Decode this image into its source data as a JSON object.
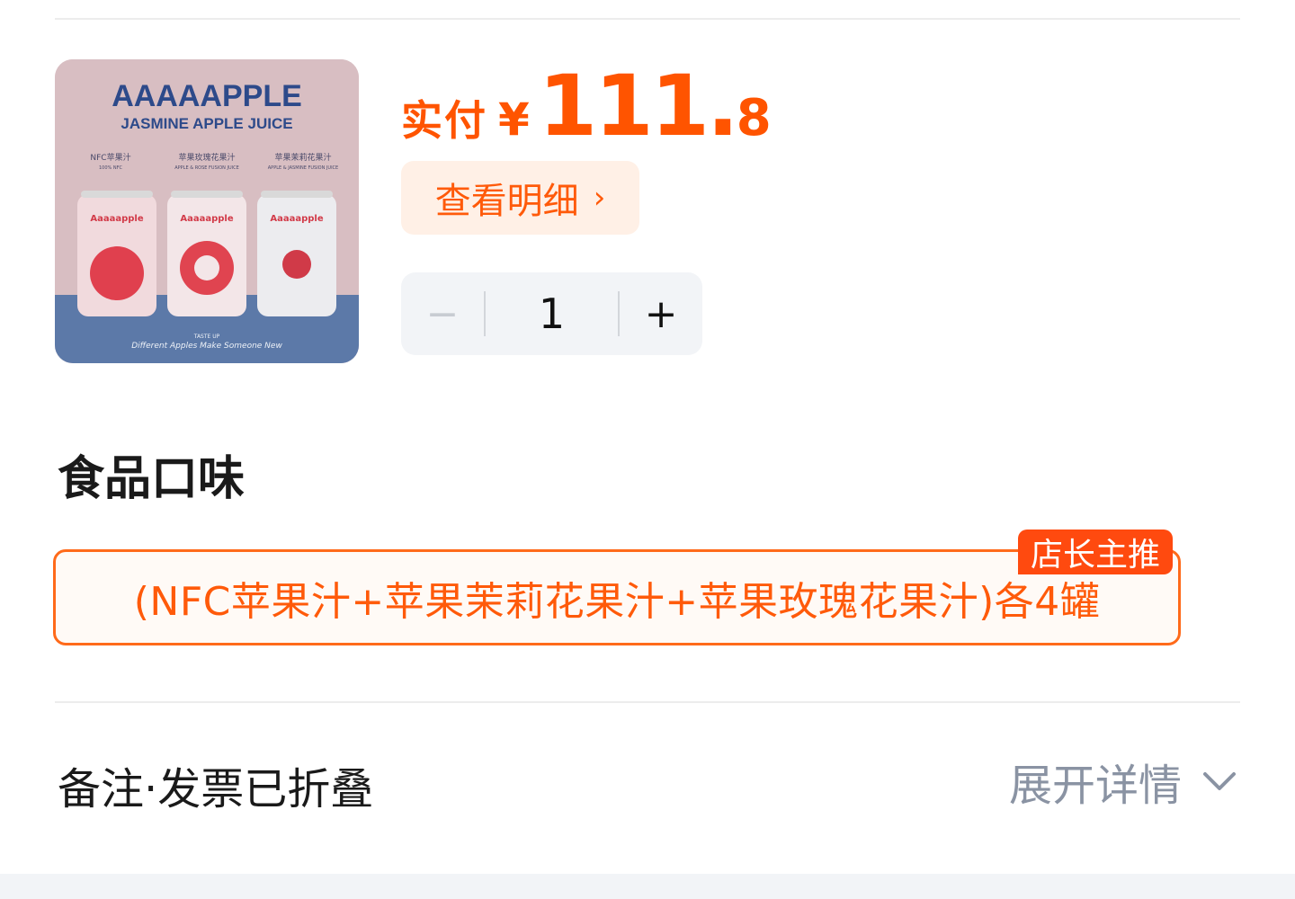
{
  "product": {
    "image": {
      "brand_title": "AAAAAPPLE",
      "subtitle": "JASMINE APPLE JUICE",
      "can_labels": [
        "NFC苹果汁",
        "苹果玫瑰花果汁",
        "苹果茉莉花果汁"
      ],
      "can_sub": [
        "100% NFC",
        "APPLE & ROSE FUSION JUICE",
        "APPLE & JASMINE FUSION JUICE"
      ],
      "can_brand": "Aaaaapple",
      "footer_small": "TASTE UP",
      "footer": "Different Apples Make Someone New"
    }
  },
  "price": {
    "label": "实付",
    "currency": "¥",
    "integer": "111.",
    "decimal": "8"
  },
  "detail_button": {
    "label": "查看明细",
    "chevron": "›"
  },
  "quantity": {
    "minus": "−",
    "value": "1",
    "plus": "+"
  },
  "flavor": {
    "title": "食品口味",
    "options": [
      {
        "label": "(NFC苹果汁+苹果茉莉花果汁+苹果玫瑰花果汁)各4罐",
        "badge": "店长主推",
        "selected": true
      }
    ]
  },
  "notes": {
    "title": "备注·发票已折叠",
    "expand_label": "展开详情",
    "expand_icon": "chevron-down-icon"
  },
  "colors": {
    "accent": "#ff5400",
    "muted": "#8a93a3"
  }
}
